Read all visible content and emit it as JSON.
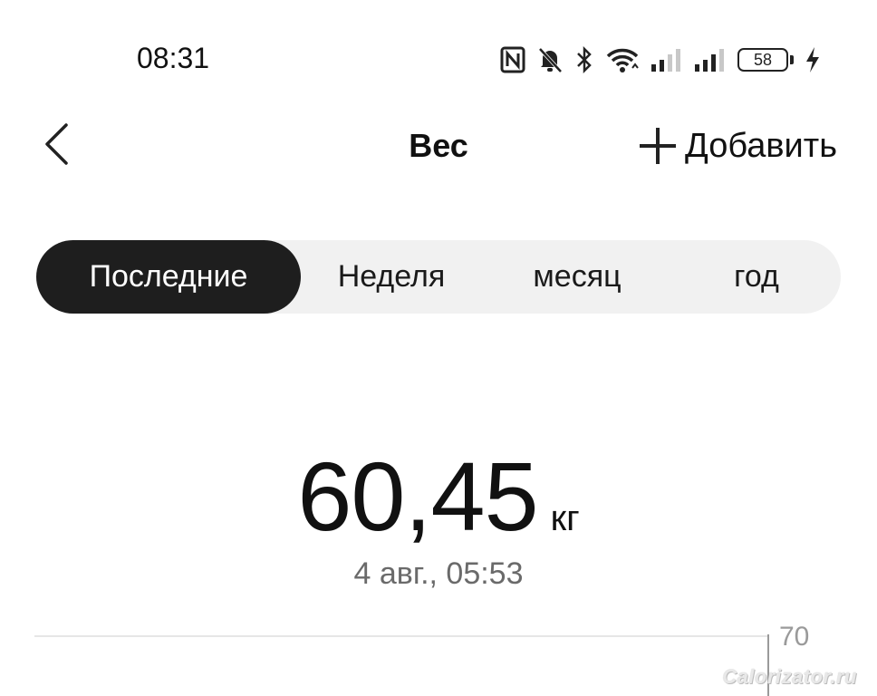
{
  "status_bar": {
    "time": "08:31",
    "battery": "58",
    "icons": [
      "nfc-icon",
      "bell-off-icon",
      "bluetooth-icon",
      "wifi-icon",
      "signal-icon",
      "signal-icon",
      "battery-icon",
      "charging-icon"
    ]
  },
  "header": {
    "title": "Вес",
    "add_label": "Добавить"
  },
  "tabs": [
    {
      "label": "Последние",
      "active": true
    },
    {
      "label": "Неделя",
      "active": false
    },
    {
      "label": "месяц",
      "active": false
    },
    {
      "label": "год",
      "active": false
    }
  ],
  "reading": {
    "value": "60,45",
    "unit": "кг",
    "timestamp": "4 авг., 05:53"
  },
  "chart": {
    "y_tick_label": "70"
  },
  "watermark": "Calorizator.ru",
  "colors": {
    "active_tab_bg": "#1e1e1e",
    "tabs_bg": "#f1f1f1",
    "secondary_text": "#6a6a6a"
  }
}
